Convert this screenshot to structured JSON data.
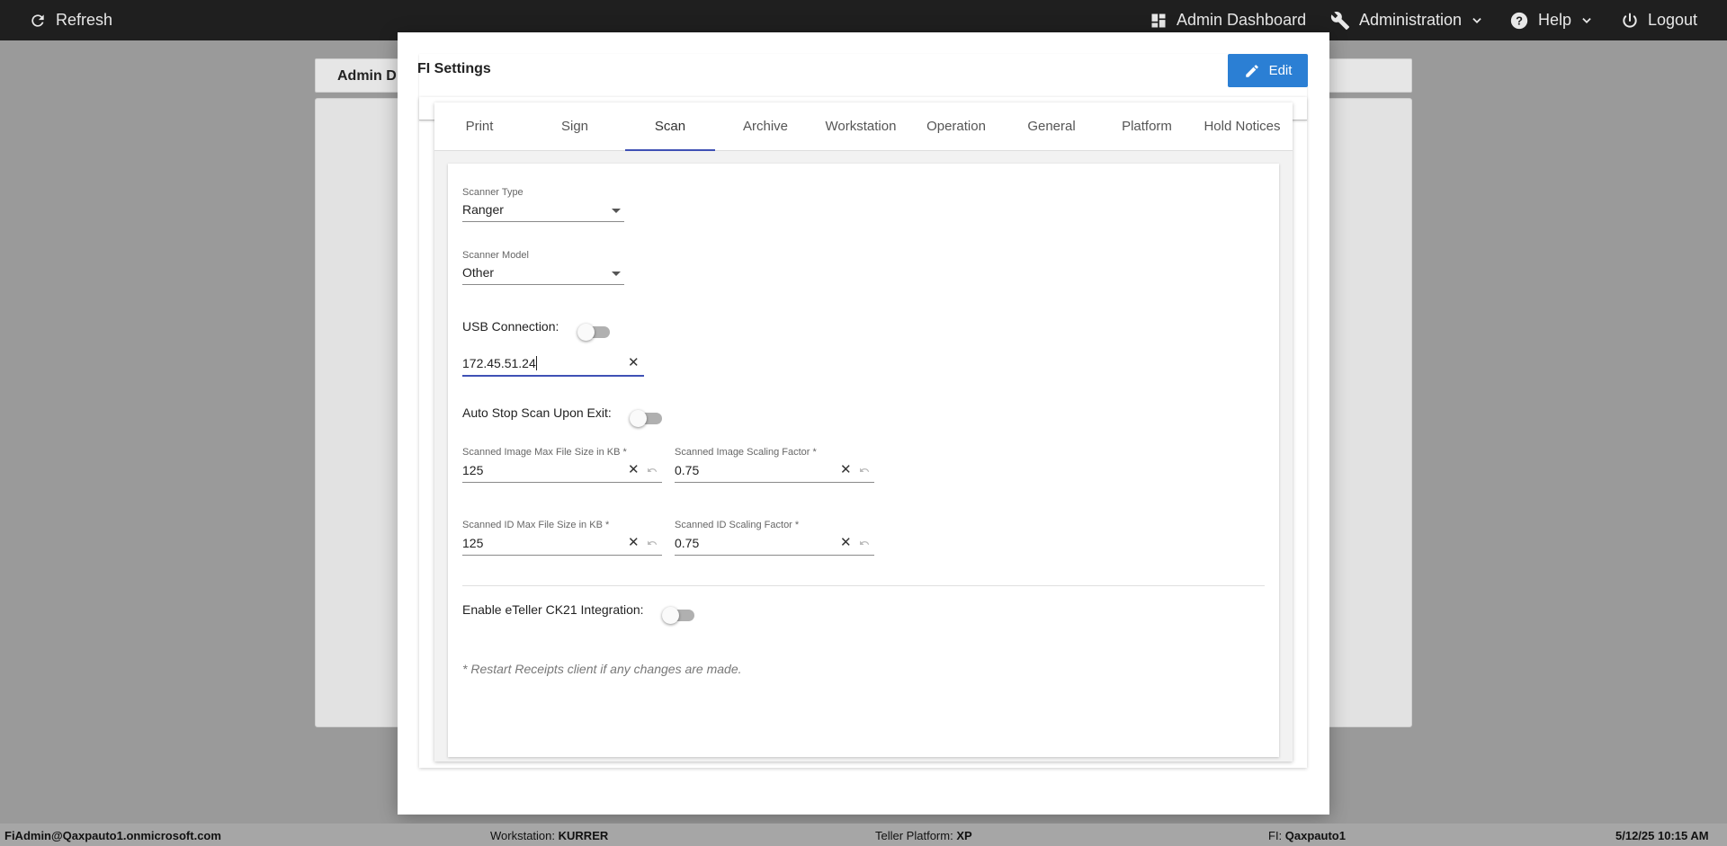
{
  "topbar": {
    "refresh_label": "Refresh",
    "admin_dashboard_label": "Admin Dashboard",
    "administration_label": "Administration",
    "help_label": "Help",
    "logout_label": "Logout"
  },
  "background": {
    "header_title": "Admin D"
  },
  "modal": {
    "title": "FI Settings",
    "edit_label": "Edit",
    "tabs": [
      {
        "label": "Print"
      },
      {
        "label": "Sign"
      },
      {
        "label": "Scan"
      },
      {
        "label": "Archive"
      },
      {
        "label": "Workstation"
      },
      {
        "label": "Operation"
      },
      {
        "label": "General"
      },
      {
        "label": "Platform"
      },
      {
        "label": "Hold Notices"
      }
    ],
    "active_tab": "Scan"
  },
  "scan": {
    "scanner_type": {
      "label": "Scanner Type",
      "value": "Ranger"
    },
    "scanner_model": {
      "label": "Scanner Model",
      "value": "Other"
    },
    "usb_connection": {
      "label": "USB Connection:",
      "on": false
    },
    "ip_address": {
      "value": "172.45.51.24"
    },
    "auto_stop": {
      "label": "Auto Stop Scan Upon Exit:",
      "on": false
    },
    "image_max_size": {
      "label": "Scanned Image Max File Size in KB *",
      "value": "125"
    },
    "image_scaling": {
      "label": "Scanned Image Scaling Factor *",
      "value": "0.75"
    },
    "id_max_size": {
      "label": "Scanned ID Max File Size in KB *",
      "value": "125"
    },
    "id_scaling": {
      "label": "Scanned ID Scaling Factor *",
      "value": "0.75"
    },
    "eteller": {
      "label": "Enable eTeller CK21 Integration:",
      "on": false
    },
    "note": "* Restart Receipts client if any changes are made."
  },
  "statusbar": {
    "user": "FiAdmin@Qaxpauto1.onmicrosoft.com",
    "workstation_label": "Workstation:",
    "workstation_value": "KURRER",
    "platform_label": "Teller Platform:",
    "platform_value": "XP",
    "fi_label": "FI:",
    "fi_value": "Qaxpauto1",
    "datetime": "5/12/25 10:15 AM"
  },
  "colors": {
    "topbar_bg": "#1f1f1f",
    "edit_button": "#2b7fd4",
    "tab_indicator": "#3f51b5",
    "overlay": "#9a9a9a"
  }
}
